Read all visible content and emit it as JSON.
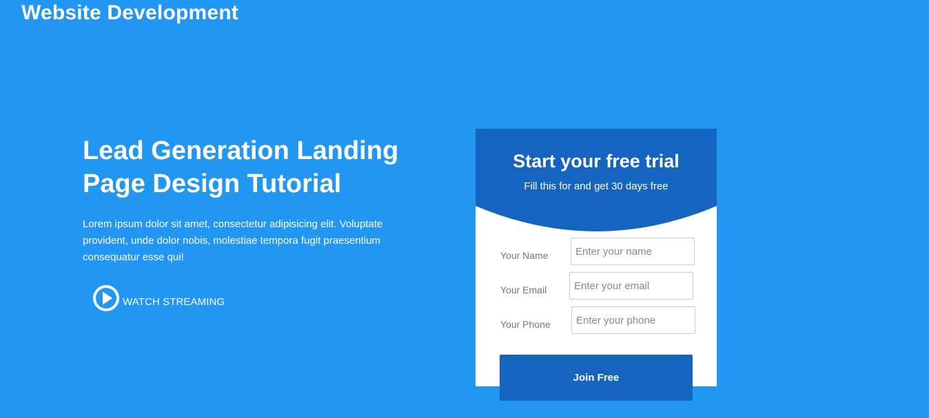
{
  "brand": {
    "title": "Website Development"
  },
  "hero": {
    "title": "Lead Generation Landing Page Design Tutorial",
    "text": "Lorem ipsum dolor sit amet, consectetur adipisicing elit. Voluptate provident, unde dolor nobis, molestiae tempora fugit praesentium consequatur esse qui!",
    "watch_label": "WATCH STREAMING",
    "watch_icon": "play-circle-icon"
  },
  "signup": {
    "title": "Start your free trial",
    "subtitle": "Fill this for and get 30 days free",
    "fields": [
      {
        "label": "Your Name",
        "placeholder": "Enter your name",
        "value": ""
      },
      {
        "label": "Your Email",
        "placeholder": "Enter your email",
        "value": ""
      },
      {
        "label": "Your Phone",
        "placeholder": "Enter your phone",
        "value": ""
      }
    ],
    "submit_label": "Join Free"
  },
  "colors": {
    "background": "#2196f3",
    "header_dark": "#1565c0",
    "card": "#ffffff",
    "label_text": "#777777"
  }
}
